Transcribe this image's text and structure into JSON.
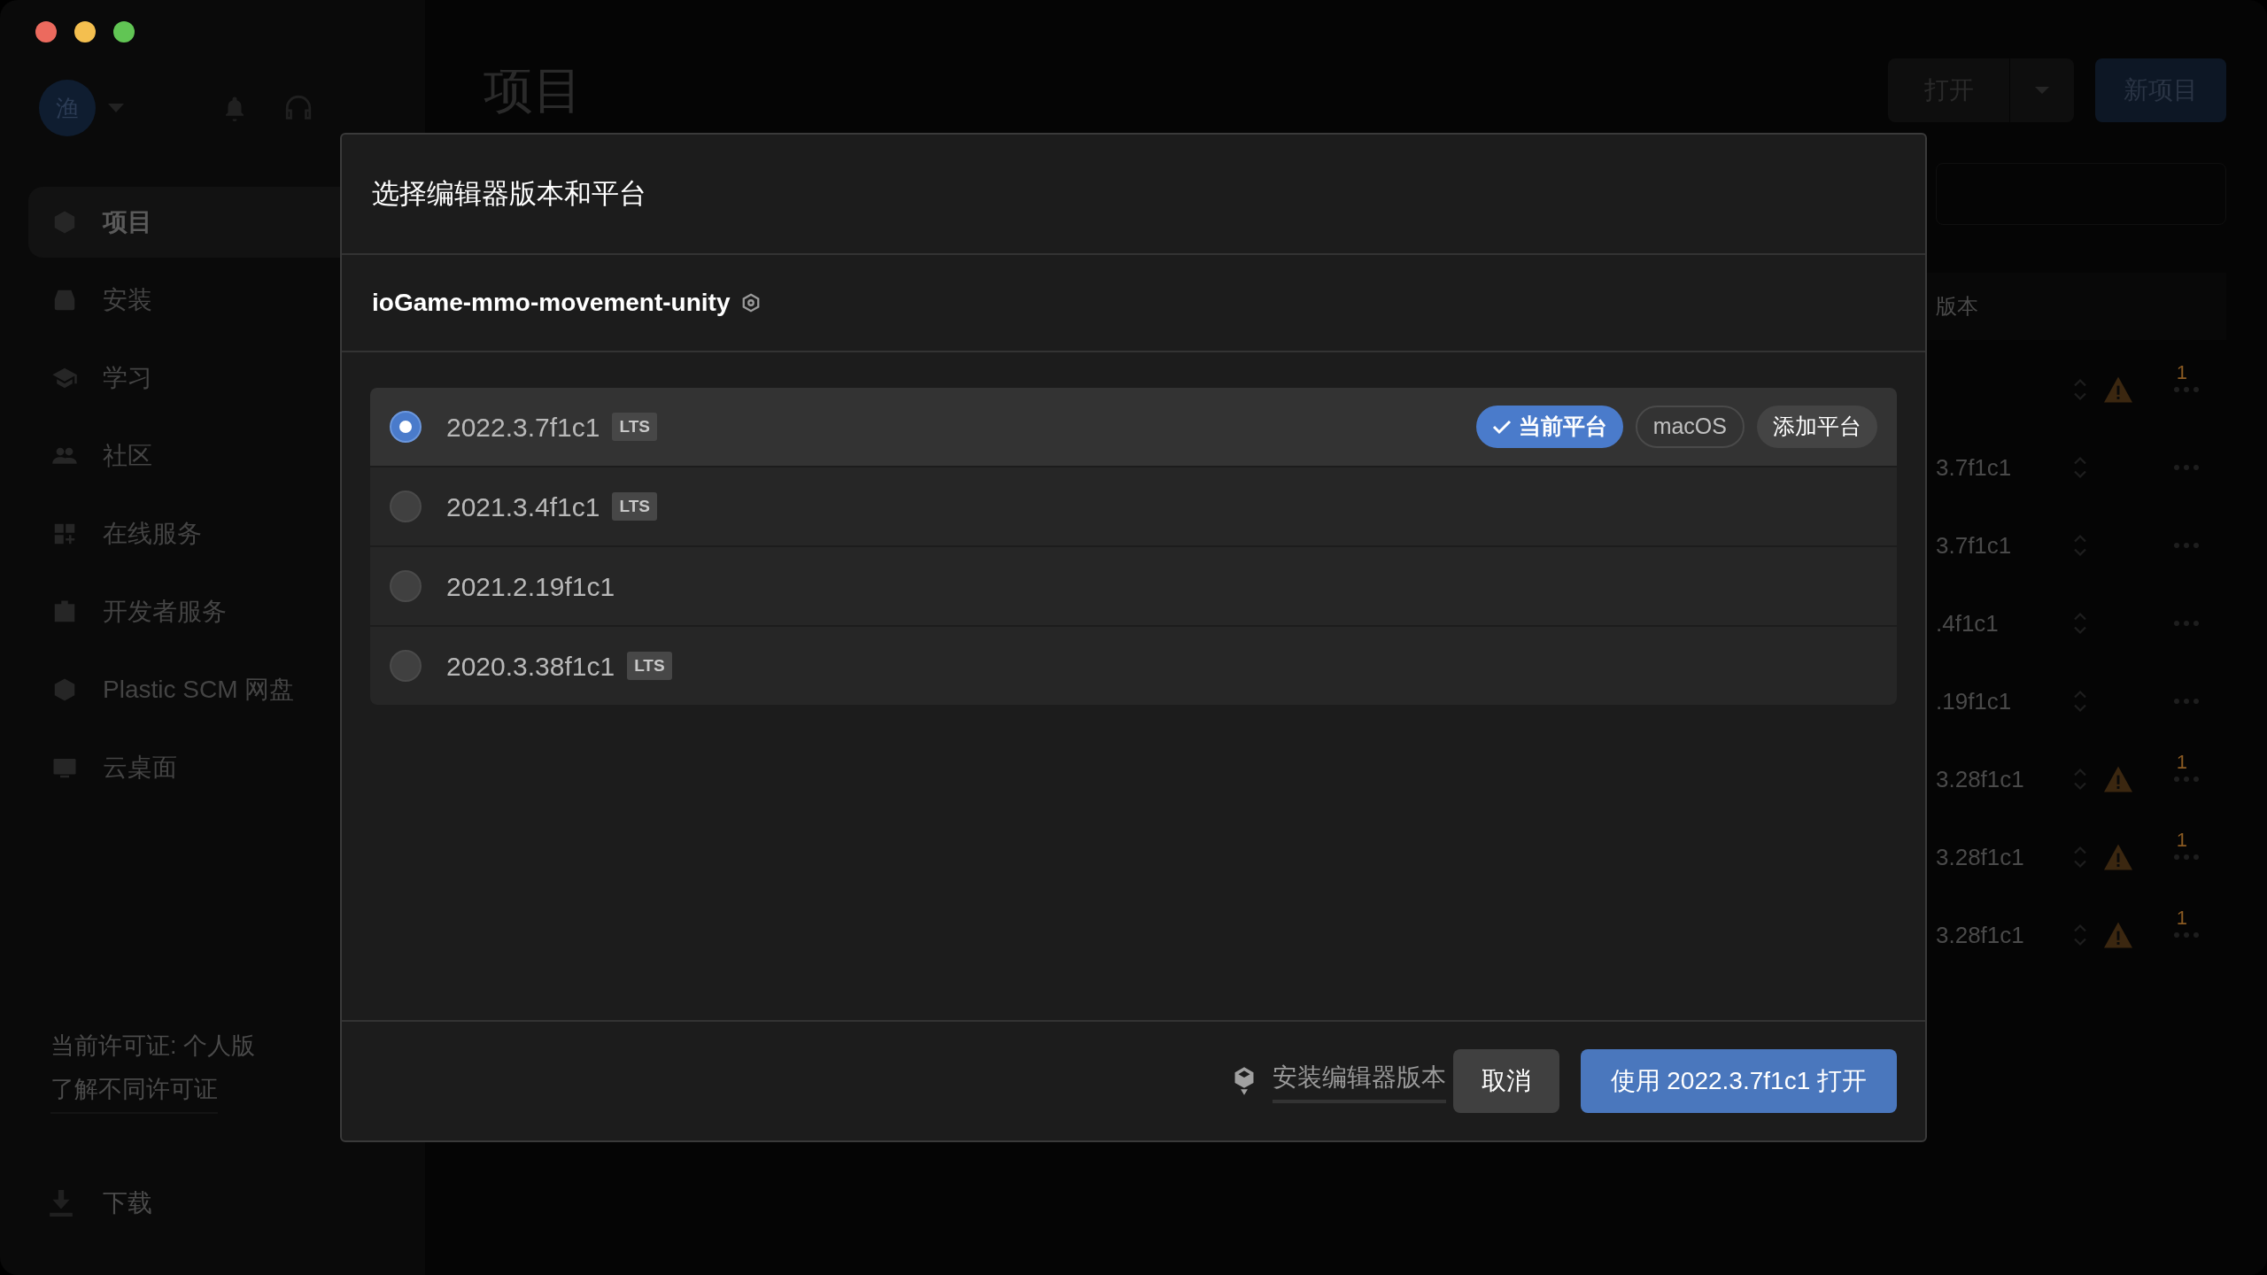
{
  "sidebar": {
    "avatar": "渔",
    "items": [
      {
        "label": "项目",
        "selected": true
      },
      {
        "label": "安装",
        "selected": false
      },
      {
        "label": "学习",
        "selected": false
      },
      {
        "label": "社区",
        "selected": false
      },
      {
        "label": "在线服务",
        "selected": false
      },
      {
        "label": "开发者服务",
        "selected": false
      },
      {
        "label": "Plastic SCM 网盘",
        "selected": false
      },
      {
        "label": "云桌面",
        "selected": false
      }
    ],
    "license": "当前许可证: 个人版",
    "license_link": "了解不同许可证",
    "download": "下载"
  },
  "main": {
    "title": "项目",
    "open_button": "打开",
    "new_button": "新项目",
    "column_header": "版本",
    "rows": [
      {
        "warning": "1"
      },
      {
        "version": "3.7f1c1"
      },
      {
        "version": "3.7f1c1"
      },
      {
        "version": ".4f1c1"
      },
      {
        "version": ".19f1c1"
      },
      {
        "version": "3.28f1c1",
        "warning": "1"
      },
      {
        "version": "3.28f1c1",
        "warning": "1"
      },
      {
        "version": "3.28f1c1",
        "warning": "1"
      }
    ]
  },
  "dialog": {
    "title": "选择编辑器版本和平台",
    "project": "ioGame-mmo-movement-unity",
    "versions": [
      {
        "version": "2022.3.7f1c1",
        "badge": "LTS",
        "selected": true,
        "platforms": [
          {
            "label": "当前平台",
            "kind": "current"
          },
          {
            "label": "macOS",
            "kind": "chip"
          },
          {
            "label": "添加平台",
            "kind": "add"
          }
        ]
      },
      {
        "version": "2021.3.4f1c1",
        "badge": "LTS",
        "selected": false
      },
      {
        "version": "2021.2.19f1c1",
        "selected": false
      },
      {
        "version": "2020.3.38f1c1",
        "badge": "LTS",
        "selected": false
      }
    ],
    "install_link": "安装编辑器版本",
    "cancel": "取消",
    "confirm": "使用 2022.3.7f1c1 打开"
  }
}
